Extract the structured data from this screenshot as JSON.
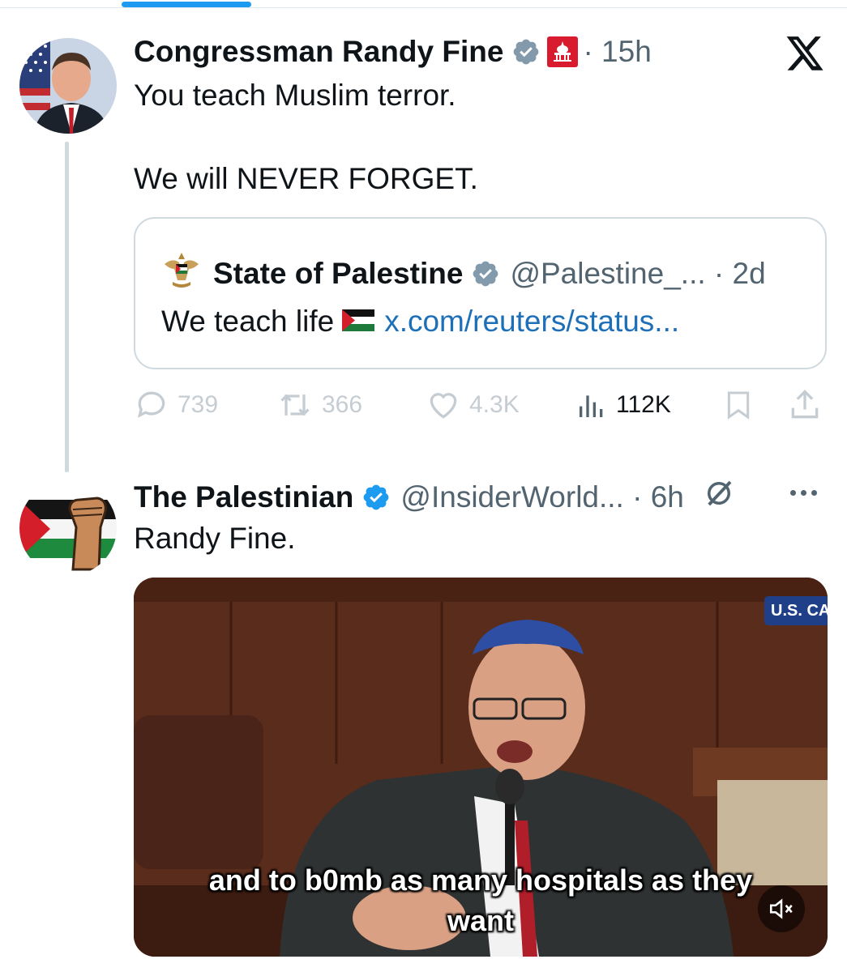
{
  "tweet1": {
    "display_name": "Congressman Randy Fine",
    "time": "· 15h",
    "text_line1": "You teach Muslim terror.",
    "text_line2": "We will NEVER FORGET.",
    "quote": {
      "display_name": "State of Palestine",
      "handle_time": "@Palestine_... · 2d",
      "text": "We teach life",
      "link": "x.com/reuters/status..."
    },
    "metrics": {
      "replies": "739",
      "reposts": "366",
      "likes": "4.3K",
      "views": "112K"
    }
  },
  "tweet2": {
    "display_name": "The Palestinian",
    "handle_time": "@InsiderWorld... · 6h",
    "text": "Randy Fine.",
    "video": {
      "channel_tag": "U.S. CA",
      "caption_line1": "and to b0mb as many hospitals as they",
      "caption_line2": "want"
    }
  },
  "colors": {
    "verified_blue": "#1d9bf0",
    "gov_badge_gray": "#829aab",
    "link_blue": "#1d6fb8",
    "muted_text": "#536471",
    "tab_indicator": "#1d9bf0"
  },
  "icons": {
    "verified": "verified-badge-icon",
    "gov": "gov-badge-icon",
    "x_logo": "x-logo-icon",
    "reply": "reply-icon",
    "repost": "repost-icon",
    "like": "heart-icon",
    "views": "views-icon",
    "bookmark": "bookmark-icon",
    "share": "share-icon",
    "grok": "grok-icon",
    "more": "more-dots-icon",
    "mute": "mute-icon"
  }
}
